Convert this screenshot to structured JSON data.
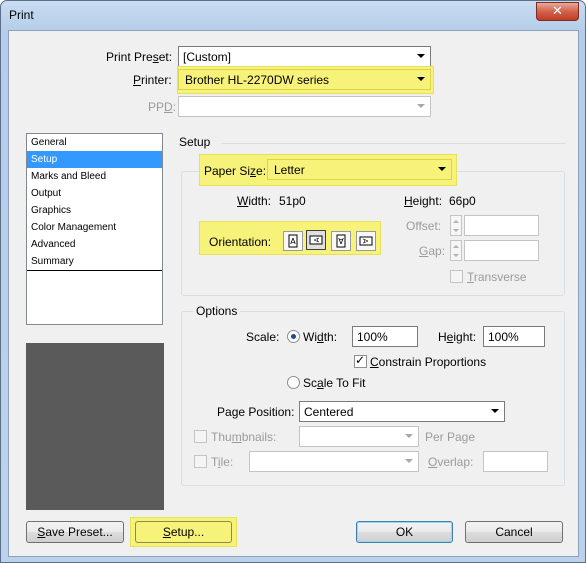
{
  "window": {
    "title": "Print",
    "close_glyph": "✕"
  },
  "print_preset": {
    "label": "Print Preset:",
    "value": "[Custom]"
  },
  "printer": {
    "label": "Printer:",
    "value": "Brother HL-2270DW series"
  },
  "ppd": {
    "label": "PPD:",
    "value": ""
  },
  "sidebar": {
    "items": [
      {
        "label": "General"
      },
      {
        "label": "Setup"
      },
      {
        "label": "Marks and Bleed"
      },
      {
        "label": "Output"
      },
      {
        "label": "Graphics"
      },
      {
        "label": "Color Management"
      },
      {
        "label": "Advanced"
      },
      {
        "label": "Summary"
      }
    ],
    "selected": "Setup"
  },
  "setup": {
    "section_title": "Setup",
    "paper_size": {
      "label": "Paper Size:",
      "value": "Letter"
    },
    "width": {
      "label": "Width:",
      "value": "51p0"
    },
    "height": {
      "label": "Height:",
      "value": "66p0"
    },
    "orientation": {
      "label": "Orientation:",
      "options": [
        "portrait",
        "landscape",
        "reverse-portrait",
        "reverse-landscape"
      ],
      "selected": "landscape"
    },
    "offset": {
      "label": "Offset:",
      "value": ""
    },
    "gap": {
      "label": "Gap:",
      "value": ""
    },
    "transverse": {
      "label": "Transverse",
      "checked": false
    }
  },
  "options": {
    "group_title": "Options",
    "scale": {
      "label": "Scale:"
    },
    "width": {
      "label": "Width:",
      "value": "100%",
      "selected": true
    },
    "height": {
      "label": "Height:",
      "value": "100%"
    },
    "constrain": {
      "label": "Constrain Proportions",
      "checked": true,
      "check_glyph": "✓"
    },
    "scale_to_fit": {
      "label": "Scale To Fit",
      "selected": false
    },
    "page_position": {
      "label": "Page Position:",
      "value": "Centered"
    },
    "thumbnails": {
      "label": "Thumbnails:",
      "value": "",
      "per_page": "Per Page",
      "checked": false
    },
    "tile": {
      "label": "Tile:",
      "value": "",
      "checked": false
    },
    "overlap": {
      "label": "Overlap:",
      "value": ""
    }
  },
  "buttons": {
    "save_preset": "Save Preset...",
    "setup": "Setup...",
    "ok": "OK",
    "cancel": "Cancel"
  },
  "colors": {
    "highlight": "#f6f27a",
    "selection": "#3399ff",
    "preview": "#5a5a5a"
  }
}
